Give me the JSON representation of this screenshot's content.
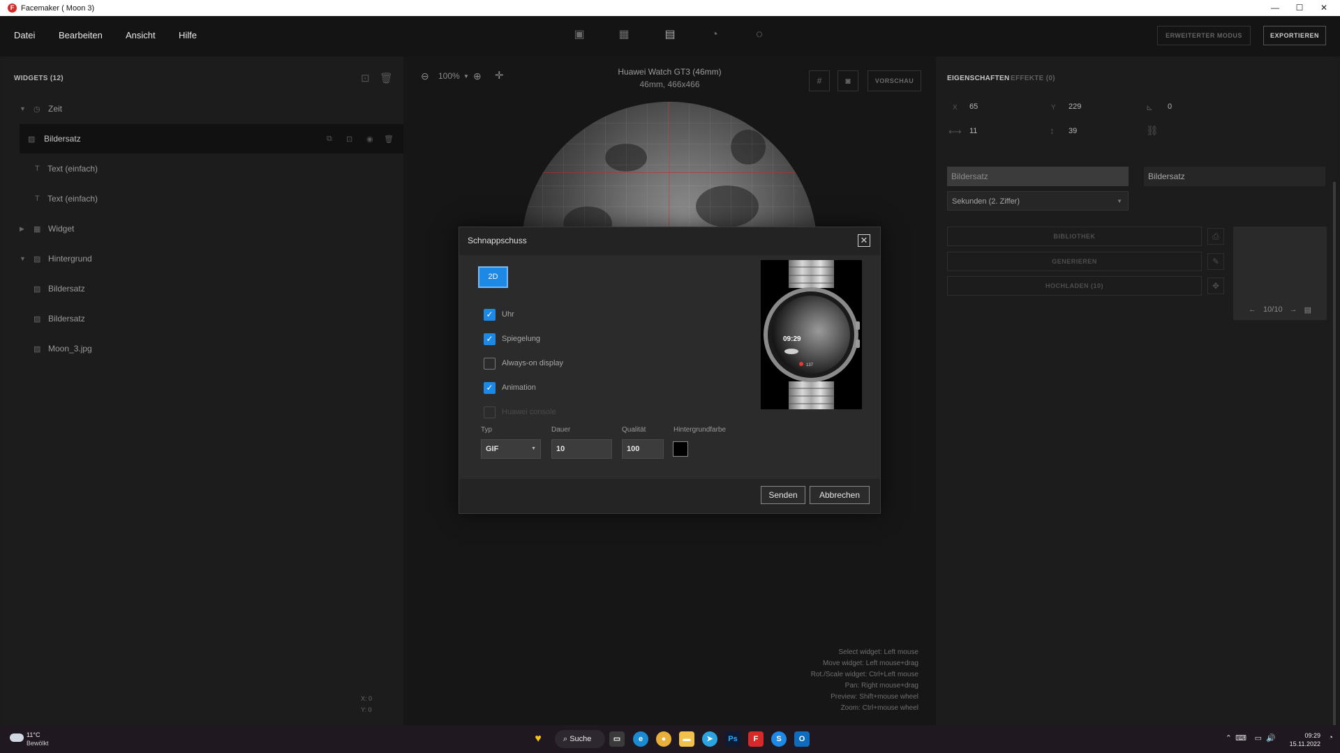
{
  "window": {
    "title": "Facemaker ( Moon 3)",
    "minimize": "—",
    "maximize": "☐",
    "close": "✕"
  },
  "menu": {
    "items": [
      "Datei",
      "Bearbeiten",
      "Ansicht",
      "Hilfe"
    ]
  },
  "top_buttons": {
    "advanced": "ERWEITERTER MODUS",
    "export": "EXPORTIEREN"
  },
  "widgets": {
    "header": "WIDGETS (12)",
    "rows": [
      {
        "label": "Zeit",
        "type": "group",
        "expanded": true
      },
      {
        "label": "Bildersatz",
        "type": "child",
        "selected": true
      },
      {
        "label": "Text (einfach)",
        "type": "child"
      },
      {
        "label": "Text (einfach)",
        "type": "child"
      },
      {
        "label": "Widget",
        "type": "group",
        "expanded": false
      },
      {
        "label": "Hintergrund",
        "type": "group",
        "expanded": true
      },
      {
        "label": "Bildersatz",
        "type": "child"
      },
      {
        "label": "Bildersatz",
        "type": "child"
      },
      {
        "label": "Moon_3.jpg",
        "type": "child"
      }
    ],
    "coords": {
      "x": "X: 0",
      "y": "Y: 0"
    }
  },
  "canvas": {
    "zoom": "100%",
    "device_name": "Huawei Watch GT3 (46mm)",
    "device_size": "46mm, 466x466",
    "preview_button": "VORSCHAU",
    "hints": [
      "Select widget: Left mouse",
      "Move widget: Left mouse+drag",
      "Rot./Scale widget: Ctrl+Left mouse",
      "Pan: Right mouse+drag",
      "Preview: Shift+mouse wheel",
      "Zoom: Ctrl+mouse wheel"
    ]
  },
  "properties": {
    "tab_properties": "EIGENSCHAFTEN",
    "tab_effects": "EFFEKTE (0)",
    "x_label": "X",
    "x": "65",
    "y_label": "Y",
    "y": "229",
    "rotation": "0",
    "width": "11",
    "height": "39",
    "name_field": "Bildersatz",
    "name_field2": "Bildersatz",
    "data_select": "Sekunden (2. Ziffer)",
    "btn_library": "BIBLIOTHEK",
    "btn_generate": "GENERIEREN",
    "btn_upload": "HOCHLADEN (10)",
    "pager": "10/10"
  },
  "dialog": {
    "title": "Schnappschuss",
    "mode_button": "2D",
    "options": [
      {
        "label": "Uhr",
        "checked": true,
        "disabled": false
      },
      {
        "label": "Spiegelung",
        "checked": true,
        "disabled": false
      },
      {
        "label": "Always-on display",
        "checked": false,
        "disabled": false
      },
      {
        "label": "Animation",
        "checked": true,
        "disabled": false
      },
      {
        "label": "Huawei console",
        "checked": false,
        "disabled": true
      }
    ],
    "type_label": "Typ",
    "type_value": "GIF",
    "duration_label": "Dauer",
    "duration_value": "10",
    "quality_label": "Qualität",
    "quality_value": "100",
    "bgcolor_label": "Hintergrundfarbe",
    "bgcolor": "#000000",
    "preview_time": "09:29",
    "preview_heart": "137",
    "send": "Senden",
    "cancel": "Abbrechen"
  },
  "taskbar": {
    "weather_temp": "11°C",
    "weather_text": "Bewölkt",
    "search": "Suche",
    "time": "09:29",
    "date": "15.11.2022"
  },
  "colors": {
    "accent": "#1e88e5",
    "app_red": "#d52a2a"
  }
}
